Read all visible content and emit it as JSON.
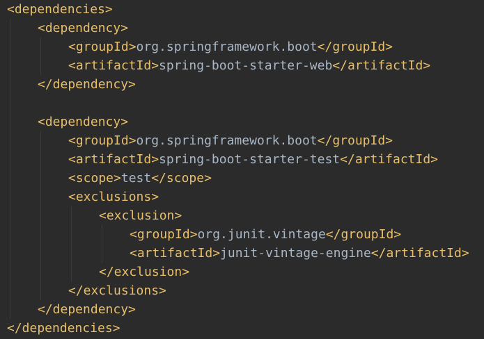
{
  "editor": {
    "colors": {
      "background": "#2b2b2b",
      "tag": "#e8bf6a",
      "text": "#a9b7c6",
      "indent_guide": "#3b3b3b"
    },
    "lines": [
      {
        "indent": 0,
        "segments": [
          {
            "kind": "tag",
            "text": "<dependencies>"
          }
        ]
      },
      {
        "indent": 1,
        "segments": [
          {
            "kind": "tag",
            "text": "<dependency>"
          }
        ]
      },
      {
        "indent": 2,
        "segments": [
          {
            "kind": "tag",
            "text": "<groupId>"
          },
          {
            "kind": "txt",
            "text": "org.springframework.boot"
          },
          {
            "kind": "tag",
            "text": "</groupId>"
          }
        ]
      },
      {
        "indent": 2,
        "segments": [
          {
            "kind": "tag",
            "text": "<artifactId>"
          },
          {
            "kind": "txt",
            "text": "spring-boot-starter-web"
          },
          {
            "kind": "tag",
            "text": "</artifactId>"
          }
        ]
      },
      {
        "indent": 1,
        "segments": [
          {
            "kind": "tag",
            "text": "</dependency>"
          }
        ]
      },
      {
        "indent": 0,
        "segments": []
      },
      {
        "indent": 1,
        "segments": [
          {
            "kind": "tag",
            "text": "<dependency>"
          }
        ]
      },
      {
        "indent": 2,
        "segments": [
          {
            "kind": "tag",
            "text": "<groupId>"
          },
          {
            "kind": "txt",
            "text": "org.springframework.boot"
          },
          {
            "kind": "tag",
            "text": "</groupId>"
          }
        ]
      },
      {
        "indent": 2,
        "segments": [
          {
            "kind": "tag",
            "text": "<artifactId>"
          },
          {
            "kind": "txt",
            "text": "spring-boot-starter-test"
          },
          {
            "kind": "tag",
            "text": "</artifactId>"
          }
        ]
      },
      {
        "indent": 2,
        "segments": [
          {
            "kind": "tag",
            "text": "<scope>"
          },
          {
            "kind": "txt",
            "text": "test"
          },
          {
            "kind": "tag",
            "text": "</scope>"
          }
        ]
      },
      {
        "indent": 2,
        "segments": [
          {
            "kind": "tag",
            "text": "<exclusions>"
          }
        ]
      },
      {
        "indent": 3,
        "segments": [
          {
            "kind": "tag",
            "text": "<exclusion>"
          }
        ]
      },
      {
        "indent": 4,
        "segments": [
          {
            "kind": "tag",
            "text": "<groupId>"
          },
          {
            "kind": "txt",
            "text": "org.junit.vintage"
          },
          {
            "kind": "tag",
            "text": "</groupId>"
          }
        ]
      },
      {
        "indent": 4,
        "segments": [
          {
            "kind": "tag",
            "text": "<artifactId>"
          },
          {
            "kind": "txt",
            "text": "junit-vintage-engine"
          },
          {
            "kind": "tag",
            "text": "</artifactId>"
          }
        ]
      },
      {
        "indent": 3,
        "segments": [
          {
            "kind": "tag",
            "text": "</exclusion>"
          }
        ]
      },
      {
        "indent": 2,
        "segments": [
          {
            "kind": "tag",
            "text": "</exclusions>"
          }
        ]
      },
      {
        "indent": 1,
        "segments": [
          {
            "kind": "tag",
            "text": "</dependency>"
          }
        ]
      },
      {
        "indent": 0,
        "segments": [
          {
            "kind": "tag",
            "text": "</dependencies>"
          }
        ]
      }
    ]
  }
}
